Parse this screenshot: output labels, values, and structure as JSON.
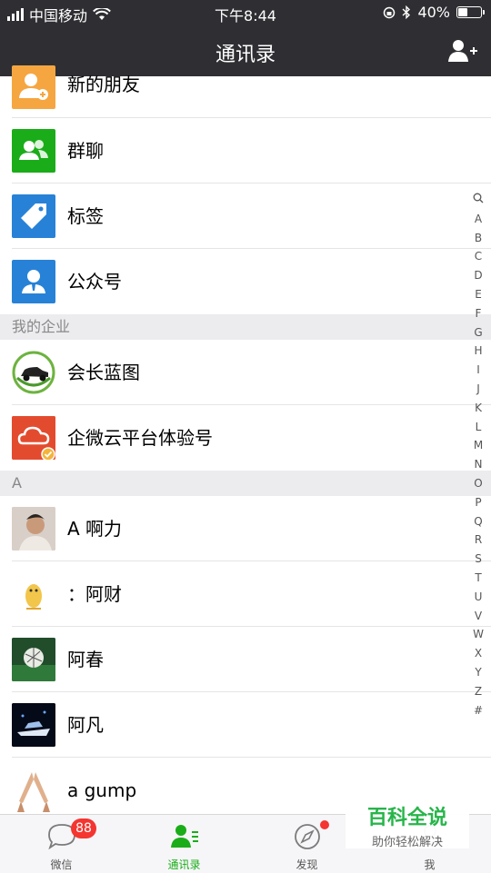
{
  "status": {
    "carrier": "中国移动",
    "time": "下午8:44",
    "battery": "40%",
    "battery_level": 0.4
  },
  "nav": {
    "title": "通讯录"
  },
  "rows_top": [
    {
      "name": "新的朋友"
    },
    {
      "name": "群聊"
    },
    {
      "name": "标签"
    },
    {
      "name": "公众号"
    }
  ],
  "sections": {
    "enterprise": "我的企业",
    "letter_a": "A"
  },
  "enterprise_rows": [
    {
      "name": "会长蓝图"
    },
    {
      "name": "企微云平台体验号"
    }
  ],
  "a_rows": [
    {
      "name": "A  啊力"
    },
    {
      "name": "：阿财"
    },
    {
      "name": "阿春"
    },
    {
      "name": "阿凡"
    },
    {
      "name": "a gump"
    }
  ],
  "index_letters": [
    "A",
    "B",
    "C",
    "D",
    "E",
    "F",
    "G",
    "H",
    "I",
    "J",
    "K",
    "L",
    "M",
    "N",
    "O",
    "P",
    "Q",
    "R",
    "S",
    "T",
    "U",
    "V",
    "W",
    "X",
    "Y",
    "Z",
    "#"
  ],
  "tabs": [
    {
      "label": "微信",
      "badge": "88"
    },
    {
      "label": "通讯录"
    },
    {
      "label": "发现"
    },
    {
      "label": "我"
    }
  ],
  "watermark": {
    "title": "百科全说",
    "subtitle": "助你轻松解决"
  },
  "colors": {
    "accent": "#1aad19",
    "nav_bg": "#2f2f33",
    "badge": "#f43530",
    "orange": "#f6a640",
    "green": "#1aad19",
    "blue": "#2782d7"
  }
}
